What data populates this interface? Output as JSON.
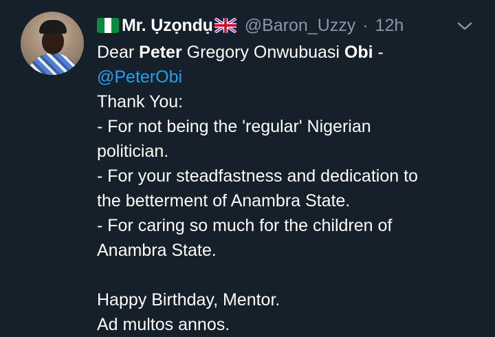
{
  "tweet": {
    "flag_left": "nigeria-flag-icon",
    "display_name": "Mr. Ụzọndụ",
    "flag_right": "uk-flag-icon",
    "handle": "@Baron_Uzzy",
    "separator": "·",
    "time": "12h",
    "lines": {
      "l1a": "Dear ",
      "l1b": "Peter",
      "l1c": " Gregory Onwubuasi ",
      "l1d": "Obi",
      "l1e": " -",
      "mention": "@PeterObi",
      "l3": "Thank You:",
      "l4": "- For not being the 'regular' Nigerian",
      "l5": "politician.",
      "l6": "- For your steadfastness and dedication to",
      "l7": "the betterment of Anambra State.",
      "l8": "- For caring so much for the children of",
      "l9": "Anambra State.",
      "l10": "Happy Birthday, Mentor.",
      "l11": "Ad multos annos."
    }
  },
  "colors": {
    "background": "#15202b",
    "secondary_text": "#8899a6",
    "mention": "#1da1f2"
  }
}
